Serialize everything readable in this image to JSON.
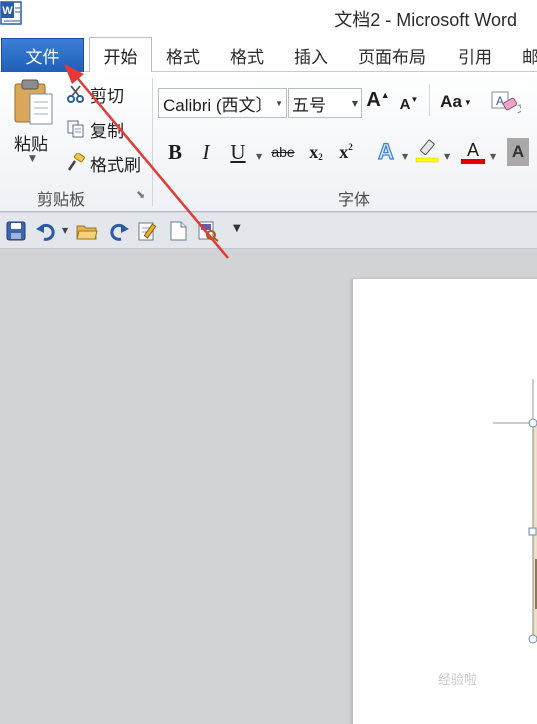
{
  "window": {
    "title": "文档2 - Microsoft Word",
    "logo_letter": "W"
  },
  "tabs": {
    "file": "文件",
    "home": "开始",
    "items": [
      "格式",
      "格式",
      "插入",
      "页面布局",
      "引用",
      "邮"
    ]
  },
  "clipboard": {
    "paste": "粘贴",
    "cut": "剪切",
    "copy": "复制",
    "format_painter": "格式刷",
    "group_label": "剪贴板",
    "launcher_icon": "dialog-launcher-icon"
  },
  "font": {
    "font_name": "Calibri (西文〕",
    "font_size": "五号",
    "grow_label": "A",
    "shrink_label": "A",
    "change_case_label": "Aa",
    "bold": "B",
    "italic": "I",
    "underline": "U",
    "strikethrough": "abe",
    "subscript": "x",
    "subscript_mark": "2",
    "superscript": "x",
    "superscript_mark": "2",
    "text_effects": "A",
    "font_color": "A",
    "shading": "A",
    "group_label": "字体"
  },
  "colors": {
    "file_tab": "#2a6bc4",
    "font_color_bar": "#e00000",
    "highlight_bar": "#ffff00",
    "annotation_arrow": "#e53935"
  },
  "qat": {
    "icons": [
      "save-icon",
      "undo-icon",
      "open-icon",
      "redo-icon",
      "edit-icon",
      "new-doc-icon",
      "print-preview-icon",
      "customize-icon"
    ]
  },
  "watermark": "经验啦"
}
